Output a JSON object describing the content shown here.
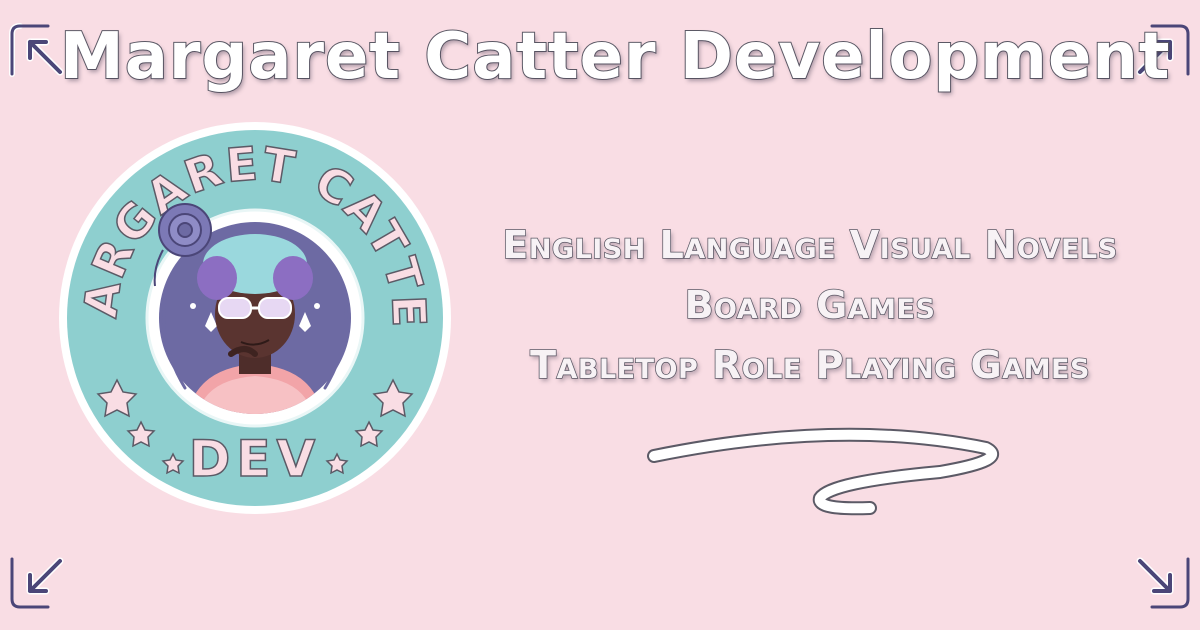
{
  "banner": {
    "title": "Margaret Catter Development",
    "categories": [
      "English Language Visual Novels",
      "Board Games",
      "Tabletop Role Playing Games"
    ]
  },
  "logo": {
    "arc_text": "MARGARET CATTER",
    "bottom_text": "DEV"
  },
  "icons": {
    "corners": [
      "arrow-top-left-icon",
      "arrow-top-right-icon",
      "arrow-bottom-left-icon",
      "arrow-bottom-right-icon"
    ],
    "badge_decor": [
      "rose-icon",
      "star-icon",
      "laurel-icon",
      "lily-icon"
    ]
  },
  "colors": {
    "background": "#f9dde4",
    "badge_teal": "#8ecfcf",
    "badge_inner_purple": "#6d6aa3",
    "text_outline": "#5c5a66",
    "corner_accent": "#4b4678"
  }
}
